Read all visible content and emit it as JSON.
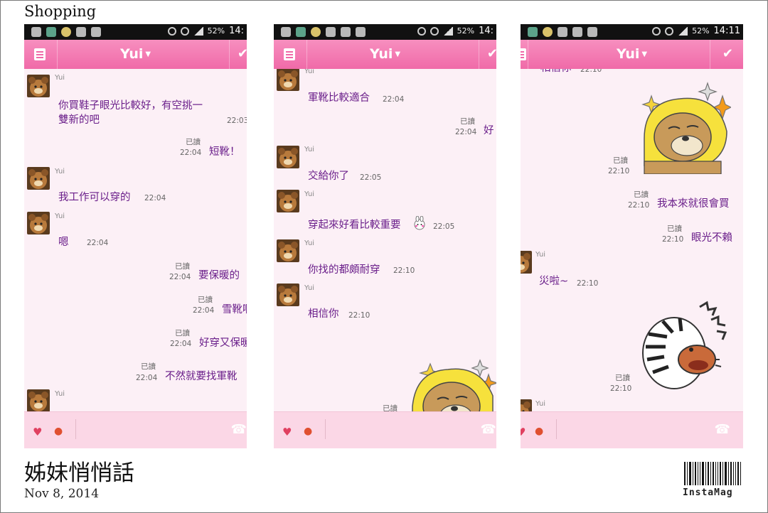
{
  "page": {
    "category": "Shopping",
    "title": "姊妹悄悄話",
    "date": "Nov 8, 2014",
    "logo_text": "InstaMag"
  },
  "screens": [
    {
      "status": {
        "battery": "52%",
        "time": "14:"
      },
      "header": {
        "title": "Yui"
      },
      "messages": [
        {
          "type": "in",
          "name": "Yui",
          "text_lines": [
            "你買鞋子眼光比較好，有空挑一",
            "雙新的吧"
          ],
          "time": "22:03"
        },
        {
          "type": "out",
          "read": "已讀",
          "time": "22:04",
          "text": "短靴！"
        },
        {
          "type": "in",
          "name": "Yui",
          "text": "我工作可以穿的",
          "time": "22:04"
        },
        {
          "type": "in",
          "name": "Yui",
          "text": "嗯",
          "time": "22:04"
        },
        {
          "type": "out",
          "read": "已讀",
          "time": "22:04",
          "text": "要保暖的"
        },
        {
          "type": "out",
          "read": "已讀",
          "time": "22:04",
          "text": "雪靴啊"
        },
        {
          "type": "out",
          "read": "已讀",
          "time": "22:04",
          "text": "好穿又保暖"
        },
        {
          "type": "out",
          "read": "已讀",
          "time": "22:04",
          "text": "不然就要找軍靴"
        },
        {
          "type": "in",
          "name": "Yui"
        }
      ]
    },
    {
      "status": {
        "battery": "52%",
        "time": "14:"
      },
      "header": {
        "title": "Yui"
      },
      "messages": [
        {
          "type": "in",
          "name": "Yui",
          "text": "軍靴比較適合",
          "time": "22:04"
        },
        {
          "type": "out",
          "read": "已讀",
          "time": "22:04",
          "text": "好"
        },
        {
          "type": "in",
          "name": "Yui",
          "text": "交給你了",
          "time": "22:05"
        },
        {
          "type": "in",
          "name": "Yui",
          "text": "穿起來好看比較重要",
          "time": "22:05"
        },
        {
          "type": "in",
          "name": "Yui",
          "text": "你找的都頗耐穿",
          "time": "22:10"
        },
        {
          "type": "in",
          "name": "Yui",
          "text": "相信你",
          "time": "22:10"
        },
        {
          "type": "sticker",
          "read": "已讀"
        }
      ]
    },
    {
      "status": {
        "battery": "52%",
        "time": "14:11"
      },
      "header": {
        "title": "Yui"
      },
      "messages": [
        {
          "type": "in",
          "text": "相信你",
          "time": "22:10"
        },
        {
          "type": "sticker",
          "read": "已讀",
          "time": "22:10"
        },
        {
          "type": "out",
          "read": "已讀",
          "time": "22:10",
          "text": "我本來就很會買"
        },
        {
          "type": "out",
          "read": "已讀",
          "time": "22:10",
          "text": "眼光不賴"
        },
        {
          "type": "in",
          "name": "Yui",
          "text": "災啦~",
          "time": "22:10"
        },
        {
          "type": "sticker",
          "read": "已讀",
          "time": "22:10"
        },
        {
          "type": "in",
          "name": "Yui"
        }
      ]
    }
  ]
}
